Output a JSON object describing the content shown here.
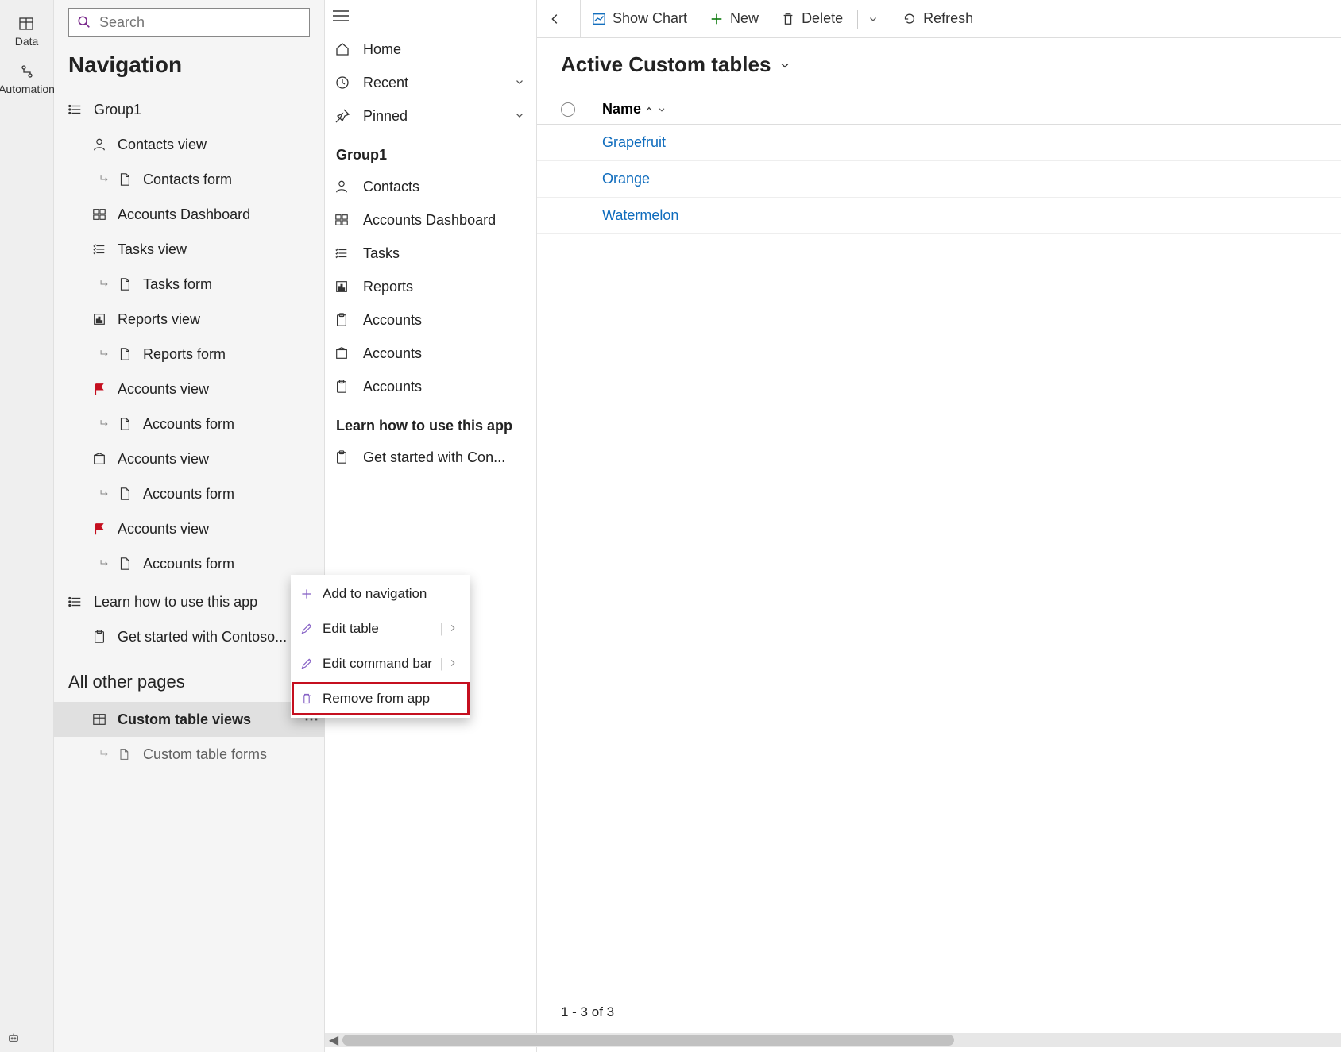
{
  "rail": [
    {
      "label": "Data",
      "icon": "table"
    },
    {
      "label": "Automation",
      "icon": "automation"
    }
  ],
  "search": {
    "placeholder": "Search"
  },
  "navTitle": "Navigation",
  "group1Label": "Group1",
  "navItems": [
    {
      "icon": "person",
      "label": "Contacts view"
    },
    {
      "sub": true,
      "icon": "doc",
      "label": "Contacts form"
    },
    {
      "icon": "dashboard",
      "label": "Accounts Dashboard"
    },
    {
      "icon": "tasks",
      "label": "Tasks view"
    },
    {
      "sub": true,
      "icon": "doc",
      "label": "Tasks form"
    },
    {
      "icon": "report",
      "label": "Reports view"
    },
    {
      "sub": true,
      "icon": "doc",
      "label": "Reports form"
    },
    {
      "icon": "flag",
      "label": "Accounts view",
      "red": true
    },
    {
      "sub": true,
      "icon": "doc",
      "label": "Accounts form"
    },
    {
      "icon": "entity",
      "label": "Accounts view"
    },
    {
      "sub": true,
      "icon": "doc",
      "label": "Accounts form"
    },
    {
      "icon": "flag",
      "label": "Accounts view",
      "red": true
    },
    {
      "sub": true,
      "icon": "doc",
      "label": "Accounts form"
    }
  ],
  "learnLabel": "Learn how to use this app",
  "learnItem": "Get started with Contoso...",
  "otherTitle": "All other pages",
  "otherItems": [
    {
      "icon": "table",
      "label": "Custom table views",
      "selected": true,
      "more": true
    },
    {
      "sub": true,
      "icon": "doc",
      "label": "Custom table forms"
    }
  ],
  "siteMap": {
    "home": "Home",
    "recent": "Recent",
    "pinned": "Pinned",
    "group": "Group1",
    "items": [
      {
        "icon": "person",
        "label": "Contacts"
      },
      {
        "icon": "dashboard",
        "label": "Accounts Dashboard"
      },
      {
        "icon": "tasks",
        "label": "Tasks"
      },
      {
        "icon": "report",
        "label": "Reports"
      },
      {
        "icon": "clipboard",
        "label": "Accounts"
      },
      {
        "icon": "entity",
        "label": "Accounts"
      },
      {
        "icon": "clipboard",
        "label": "Accounts"
      }
    ],
    "learnGroup": "Learn how to use this app",
    "learnItem": "Get started with Con..."
  },
  "cmdbar": {
    "showChart": "Show Chart",
    "new": "New",
    "delete": "Delete",
    "refresh": "Refresh"
  },
  "view": {
    "title": "Active Custom tables",
    "col": "Name",
    "rows": [
      "Grapefruit",
      "Orange",
      "Watermelon"
    ],
    "footer": "1 - 3 of 3"
  },
  "ctx": {
    "add": "Add to navigation",
    "editTable": "Edit table",
    "editCmd": "Edit command bar",
    "remove": "Remove from app"
  }
}
